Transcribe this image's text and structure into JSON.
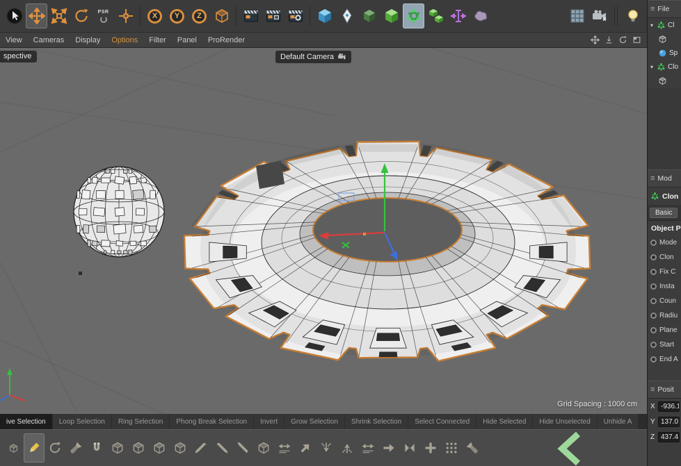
{
  "top_toolbar": {
    "psr_label": "PSR",
    "x_label": "X",
    "y_label": "Y",
    "z_label": "Z",
    "icons": [
      "live-selection-tool",
      "move-tool",
      "scale-tool",
      "rotate-tool",
      "psr-tool",
      "axis-modifier",
      "x-axis-lock",
      "y-axis-lock",
      "z-axis-lock",
      "coordinate-system",
      "render-view",
      "render-to-picture-viewer",
      "edit-render-settings",
      "add-cube-primitive",
      "pen-spline",
      "subdivision-surface",
      "generator-cube",
      "mograph-cloner",
      "array-generator",
      "bend-deformer",
      "field-deformer",
      "matrix-array",
      "camera-object",
      "light-object"
    ],
    "active_tools": [
      "move-tool",
      "mograph-cloner"
    ]
  },
  "menu_bar": {
    "items": [
      "View",
      "Cameras",
      "Display",
      "Options",
      "Filter",
      "Panel",
      "ProRender"
    ],
    "active_item": "Options"
  },
  "viewport": {
    "view_label": "spective",
    "camera_label": "Default Camera",
    "grid_spacing_label": "Grid Spacing : 1000 cm"
  },
  "selection_toolbar": {
    "buttons": [
      "ive Selection",
      "Loop Selection",
      "Ring Selection",
      "Phong Break Selection",
      "Invert",
      "Grow Selection",
      "Shrink Selection",
      "Select Connected",
      "Hide Selected",
      "Hide Unselected",
      "Unhide A"
    ],
    "active_button": "ive Selection"
  },
  "bottom_toolbar": {
    "icons": [
      "tweak-tool",
      "polygon-pen",
      "arc-tool",
      "brush-tool",
      "magnet-tool",
      "extrude",
      "extrude-inner",
      "bevel",
      "bridge",
      "knife",
      "line-cut",
      "plane-cut",
      "loop-cut",
      "edge-slide",
      "normal-move",
      "split",
      "weld",
      "stitch",
      "shift",
      "collide",
      "add-point",
      "matrix-dots",
      "fill-selection",
      "mograph-logo"
    ],
    "active_icon": "polygon-pen"
  },
  "right_panel": {
    "objects_header": "File",
    "object_tree": [
      {
        "label": "Cl",
        "icon": "cloner-icon"
      },
      {
        "label": "",
        "icon": "child-object-icon"
      },
      {
        "label": "Sp",
        "icon": "sphere-icon"
      },
      {
        "label": "Clo",
        "icon": "cloner-icon"
      },
      {
        "label": "",
        "icon": "child-object-icon"
      }
    ],
    "attributes": {
      "header": "Mod",
      "object_name": "Clon",
      "tab": "Basic",
      "section_title": "Object Pr",
      "properties": [
        "Mode",
        "Clon",
        "Fix C",
        "Insta",
        "Coun",
        "Radiu",
        "Plane",
        "Start",
        "End A"
      ]
    },
    "coordinates": {
      "header": "Posit",
      "rows": [
        {
          "axis": "X",
          "value": "-936.1"
        },
        {
          "axis": "Y",
          "value": "137.0"
        },
        {
          "axis": "Z",
          "value": "437.4"
        }
      ]
    }
  },
  "colors": {
    "accent": "#d6953f",
    "selection_outline": "#c87f35",
    "viewport_bg": "#6a6a6a",
    "axis_x": "#dd3c3c",
    "axis_y": "#35c23f",
    "axis_z": "#3d6fe0",
    "active_tool_highlight": "#93a5b2"
  }
}
